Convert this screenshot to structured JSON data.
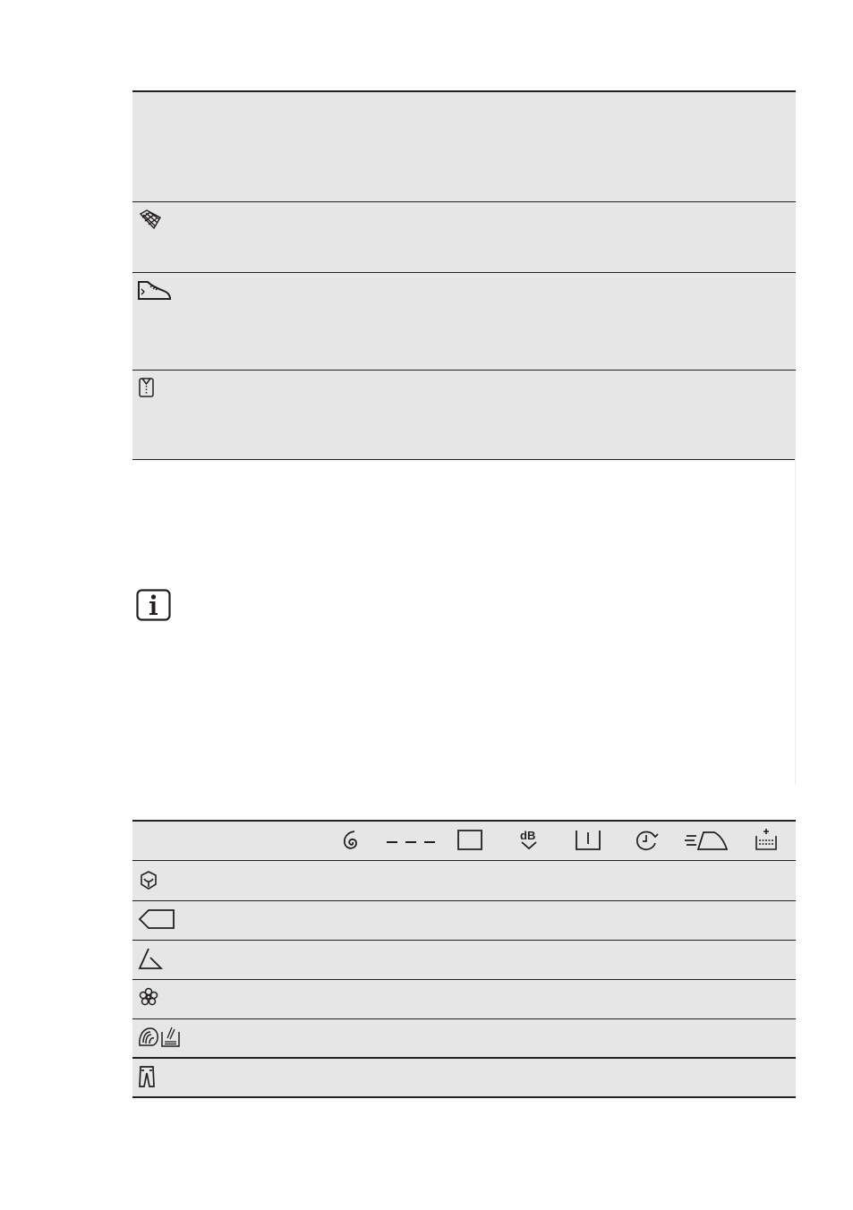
{
  "top_table": {
    "rows": [
      {
        "icon": "blank-header",
        "text": ""
      },
      {
        "icon": "net-bag-icon",
        "text": ""
      },
      {
        "icon": "sneaker-icon",
        "text": ""
      },
      {
        "icon": "shirt-icon",
        "text": ""
      }
    ]
  },
  "info_icon": "info-icon",
  "options_table": {
    "header_icons": [
      "spiral-icon",
      "dashes-icon",
      "rinse-tub-icon",
      "db-quiet-icon",
      "drain-tub-icon",
      "timer-icon",
      "iron-icon",
      "extra-rinse-icon"
    ],
    "rows": [
      {
        "icon": "eco-icon"
      },
      {
        "icon": "tag-icon"
      },
      {
        "icon": "synthetic-triangle-icon"
      },
      {
        "icon": "flower-icon"
      },
      {
        "icon": "wool-handwash-icon"
      },
      {
        "icon": "jeans-icon"
      }
    ]
  }
}
